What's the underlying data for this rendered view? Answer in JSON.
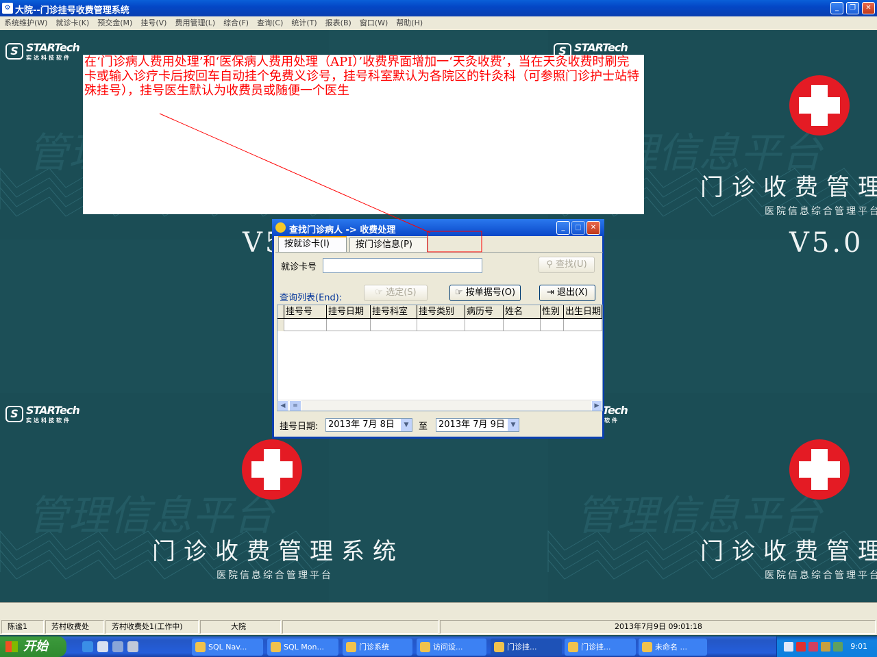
{
  "window": {
    "title": "大院--门诊挂号收费管理系统",
    "minimize": "_",
    "restore": "❐",
    "close": "✕"
  },
  "menu": [
    "系统维护(W)",
    "就诊卡(K)",
    "预交金(M)",
    "挂号(V)",
    "费用管理(L)",
    "综合(F)",
    "查询(C)",
    "统计(T)",
    "报表(B)",
    "窗口(W)",
    "帮助(H)"
  ],
  "wallpaper": {
    "logo_text": "STARTech",
    "logo_sub": "实达科技软件",
    "big_title": "门诊收费管理系统",
    "big_title_right": "门诊收费管理",
    "subtitle": "医院信息综合管理平台",
    "version": "V5.0",
    "version_partial": "V5",
    "watermark": "管理信息平台"
  },
  "note": {
    "text": "在‘门诊病人费用处理’和‘医保病人费用处理（API）’收费界面增加一‘天灸收费’，当在天灸收费时刷完卡或输入诊疗卡后按回车自动挂个免费义诊号，挂号科室默认为各院区的针灸科（可参照门诊护士站特殊挂号），挂号医生默认为收费员或随便一个医生"
  },
  "dialog": {
    "title": "查找门诊病人 -> 收费处理",
    "tabs": [
      "按就诊卡(I)",
      "按门诊信息(P)"
    ],
    "card_label": "就诊卡号",
    "card_value": "",
    "find_button": "查找(U)",
    "list_label": "查询列表(End):",
    "select_button": "选定(S)",
    "by_receipt_button": "按单据号(O)",
    "exit_button": "退出(X)",
    "columns": [
      "挂号号",
      "挂号日期",
      "挂号科室",
      "挂号类别",
      "病历号",
      "姓名",
      "性别",
      "出生日期"
    ],
    "date_label": "挂号日期:",
    "date_from": "2013年 7月 8日",
    "date_to_label": "至",
    "date_to": "2013年 7月 9日"
  },
  "statusbar": [
    "陈谧1",
    "芳村收费处",
    "芳村收费处1(工作中)",
    "大院",
    "",
    "2013年7月9日 09:01:18"
  ],
  "taskbar": {
    "start": "开始",
    "tasks": [
      "SQL Nav...",
      "SQL Mon...",
      "门诊系统",
      "访问设...",
      "门诊挂...",
      "门诊挂...",
      "未命名 ..."
    ],
    "clock": "9:01"
  },
  "colors": {
    "desktop": "#1c4f57",
    "note_text": "#ff0000",
    "cross": "#e41b24"
  }
}
